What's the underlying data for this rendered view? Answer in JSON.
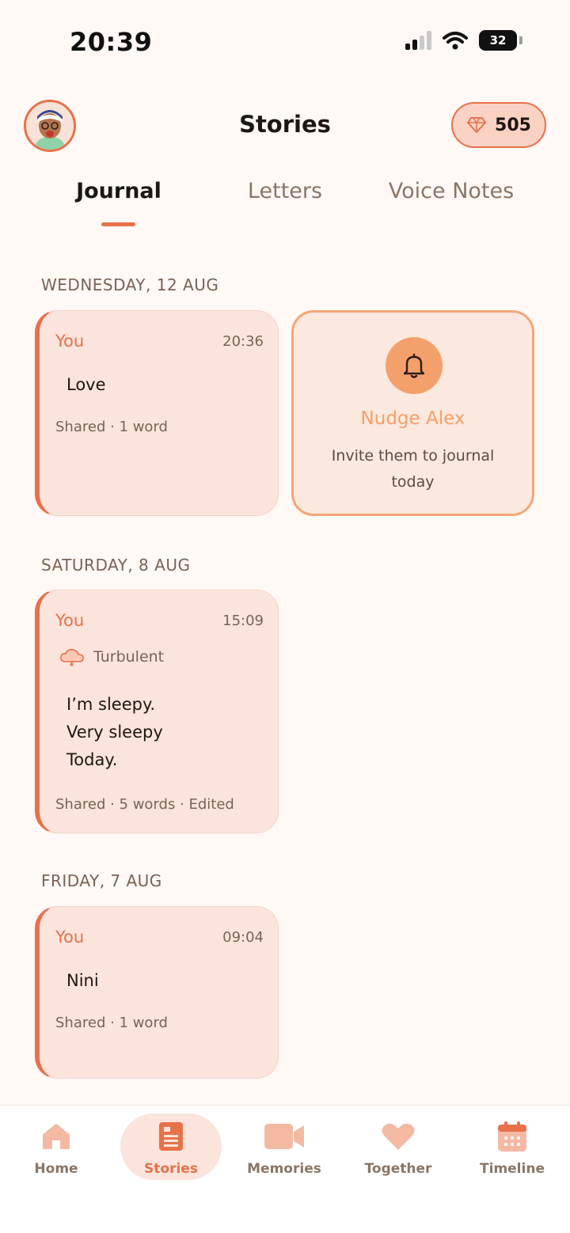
{
  "status_bar": {
    "time": "20:39",
    "battery": "32"
  },
  "header": {
    "title": "Stories",
    "gems": "505"
  },
  "tabs": [
    {
      "label": "Journal",
      "active": true
    },
    {
      "label": "Letters",
      "active": false
    },
    {
      "label": "Voice Notes",
      "active": false
    }
  ],
  "sections": [
    {
      "date": "WEDNESDAY, 12 AUG",
      "entry": {
        "author": "You",
        "time": "20:36",
        "lines": [
          "Love"
        ],
        "meta": "Shared · 1 word"
      }
    },
    {
      "date": "SATURDAY, 8 AUG",
      "entry": {
        "author": "You",
        "time": "15:09",
        "mood": "Turbulent",
        "lines": [
          "I’m sleepy.",
          "Very sleepy",
          "Today."
        ],
        "meta": "Shared · 5 words · Edited"
      }
    },
    {
      "date": "FRIDAY, 7 AUG",
      "entry": {
        "author": "You",
        "time": "09:04",
        "lines": [
          "Nini"
        ],
        "meta": "Shared · 1 word"
      }
    }
  ],
  "nudge": {
    "title": "Nudge Alex",
    "subtitle": "Invite them to journal today"
  },
  "nav": [
    {
      "label": "Home",
      "icon": "home-icon"
    },
    {
      "label": "Stories",
      "icon": "document-icon",
      "active": true
    },
    {
      "label": "Memories",
      "icon": "video-icon"
    },
    {
      "label": "Together",
      "icon": "heart-icon"
    },
    {
      "label": "Timeline",
      "icon": "calendar-icon"
    }
  ],
  "colors": {
    "accent": "#e8714a",
    "accent_light": "#f4a06b",
    "card_bg": "#fbe4dc",
    "page_bg": "#fff8f5"
  }
}
